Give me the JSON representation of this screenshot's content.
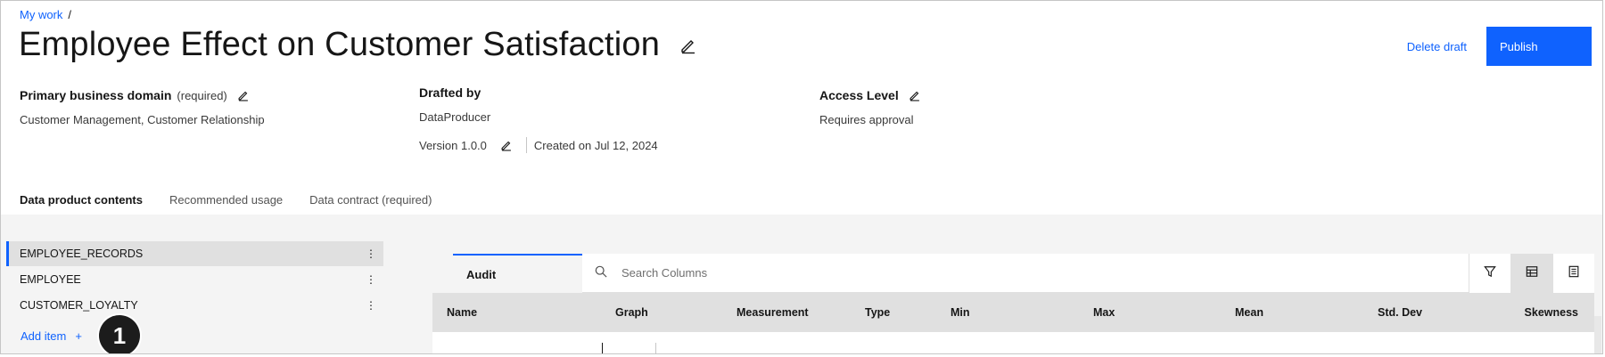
{
  "breadcrumb": {
    "link": "My work",
    "separator": "/"
  },
  "header": {
    "title": "Employee Effect on Customer Satisfaction",
    "delete_label": "Delete draft",
    "publish_label": "Publish"
  },
  "meta": {
    "domain": {
      "label": "Primary business domain",
      "required": "(required)",
      "value": "Customer Management, Customer Relationship"
    },
    "drafted": {
      "label": "Drafted by",
      "value": "DataProducer",
      "version": "Version 1.0.0",
      "created": "Created on Jul 12, 2024"
    },
    "access": {
      "label": "Access Level",
      "value": "Requires approval"
    }
  },
  "tabs": [
    {
      "label": "Data product contents",
      "active": true
    },
    {
      "label": "Recommended usage",
      "active": false
    },
    {
      "label": "Data contract (required)",
      "active": false
    }
  ],
  "assets": {
    "items": [
      {
        "label": "EMPLOYEE_RECORDS",
        "selected": true
      },
      {
        "label": "EMPLOYEE",
        "selected": false
      },
      {
        "label": "CUSTOMER_LOYALTY",
        "selected": false
      }
    ],
    "add_label": "Add item",
    "add_symbol": "+",
    "kebab": "⋮"
  },
  "step_badge": "1",
  "panel": {
    "tab_label": "Audit",
    "search_placeholder": "Search Columns",
    "columns": [
      "Name",
      "Graph",
      "Measurement",
      "Type",
      "Min",
      "Max",
      "Mean",
      "Std. Dev",
      "Skewness"
    ]
  },
  "icons": {
    "edit": "pencil-icon",
    "search": "search-icon",
    "filter": "filter-icon",
    "table_view": "table-view-icon",
    "list_view": "list-view-icon"
  },
  "colors": {
    "accent": "#0f62fe",
    "text": "#161616",
    "surface": "#f4f4f4"
  }
}
